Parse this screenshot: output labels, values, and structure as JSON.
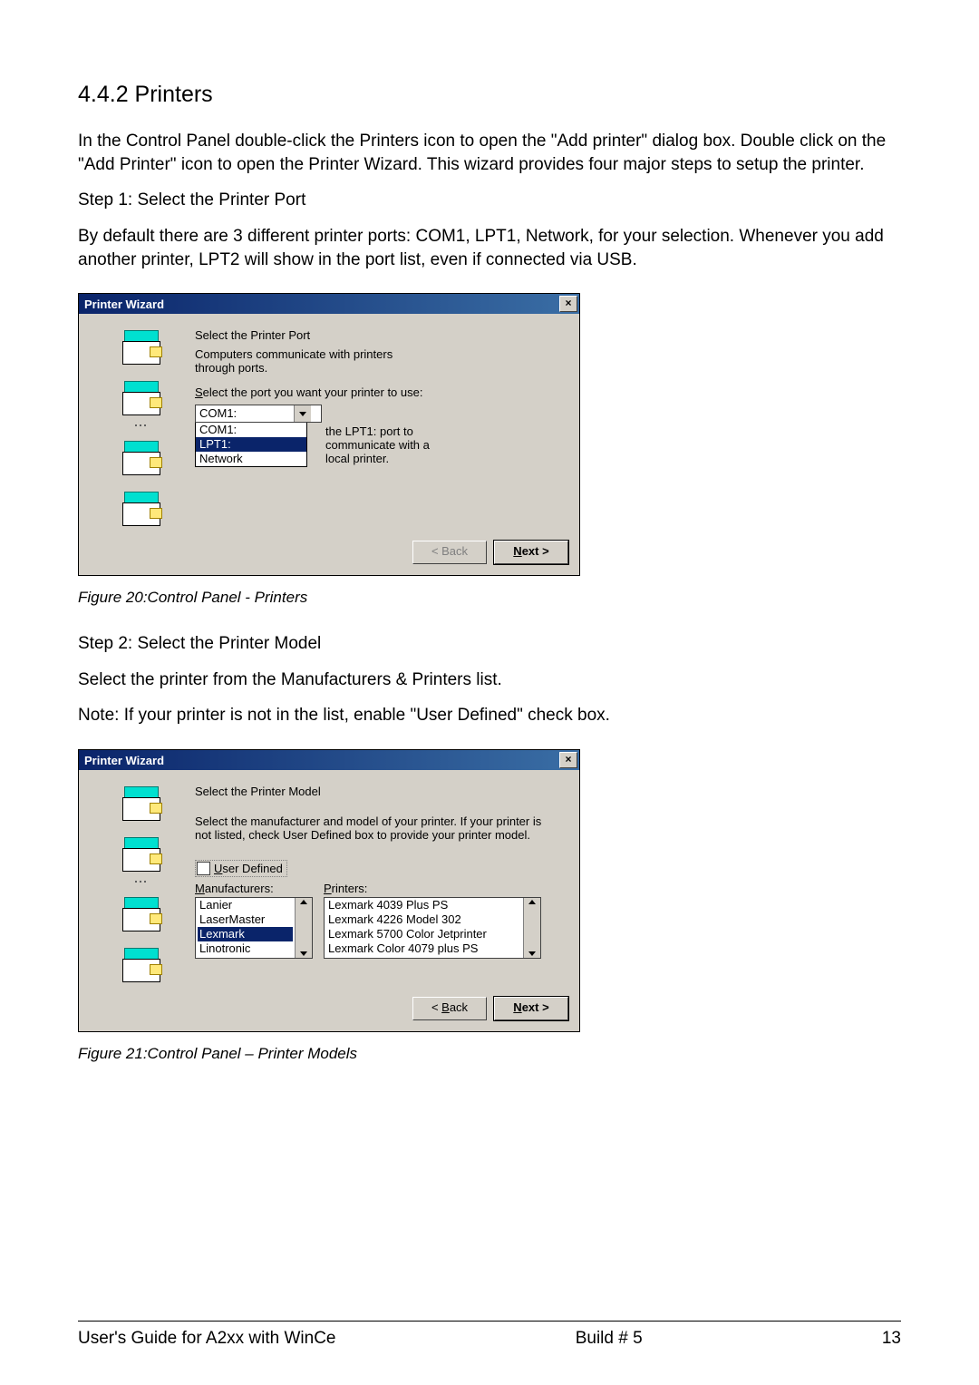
{
  "heading": "4.4.2   Printers",
  "para1": "In the Control Panel double-click the Printers icon to open the \"Add printer\" dialog box. Double click on the \"Add Printer\" icon to open the Printer Wizard. This wizard provides four major steps to setup the printer.",
  "step1_title": "Step 1: Select the Printer Port",
  "step1_desc": "By default there are 3 different printer ports: COM1, LPT1, Network, for your selection. Whenever you add another printer, LPT2 will show in the port list, even if connected via USB.",
  "dialog1": {
    "title": "Printer Wizard",
    "heading": "Select the Printer Port",
    "line1": "Computers communicate with printers through ports.",
    "line2_pre": "S",
    "line2_rest": "elect the port you want your printer to use:",
    "combo_value": "COM1:",
    "options": [
      "COM1:",
      "LPT1:",
      "Network"
    ],
    "selected_option": "LPT1:",
    "note": "the LPT1: port to communicate with a local printer.",
    "back_label": "< Back",
    "next_label_prefix": "N",
    "next_label_rest": "ext >"
  },
  "figure1_caption": "Figure 20:Control Panel - Printers",
  "step2_title": "Step 2: Select the Printer Model",
  "step2_desc": "Select the printer from the Manufacturers & Printers list.",
  "step2_note": "Note: If your printer is not in the list, enable \"User Defined\" check box.",
  "dialog2": {
    "title": "Printer Wizard",
    "heading": "Select the Printer Model",
    "line1": "Select the manufacturer and model of your printer. If your printer is not listed, check User Defined box to provide your printer model.",
    "checkbox_pre": "U",
    "checkbox_rest": "ser Defined",
    "manu_pre": "M",
    "manu_rest": "anufacturers:",
    "prt_pre": "P",
    "prt_rest": "rinters:",
    "manufacturers": [
      "Lanier",
      "LaserMaster",
      "Lexmark",
      "Linotronic"
    ],
    "manu_selected": "Lexmark",
    "printers": [
      "Lexmark 4039 Plus PS",
      "Lexmark 4226 Model 302",
      "Lexmark 5700 Color Jetprinter",
      "Lexmark Color 4079 plus PS"
    ],
    "back_label_prefix": "< ",
    "back_label_ul": "B",
    "back_label_rest": "ack",
    "next_label_prefix": "N",
    "next_label_rest": "ext >"
  },
  "figure2_caption": "Figure 21:Control Panel – Printer Models",
  "footer": {
    "left": "User's Guide for A2xx with WinCe",
    "mid": "Build # 5",
    "right": "13"
  }
}
